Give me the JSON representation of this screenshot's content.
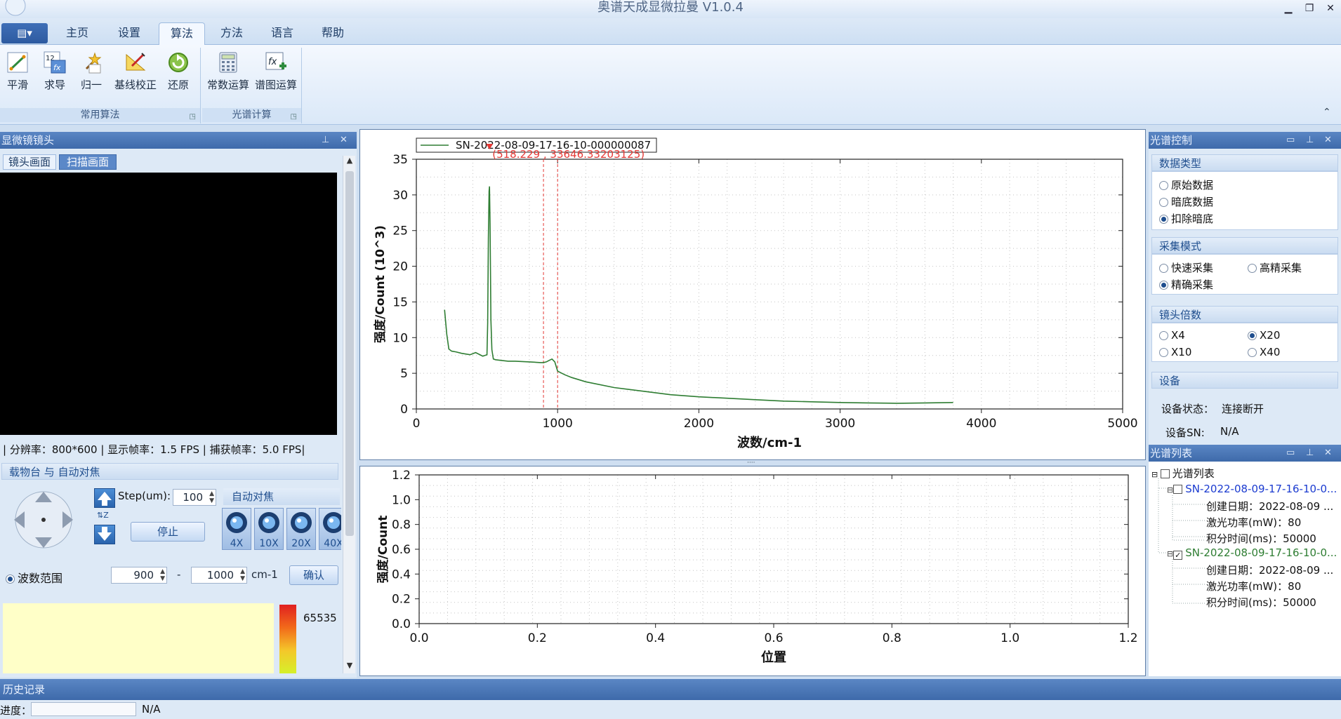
{
  "window": {
    "title": "奥谱天成显微拉曼 V1.0.4",
    "min": "▁",
    "max": "❐",
    "close": "✕"
  },
  "ribbon": {
    "app_menu": "▤▾",
    "tabs": [
      {
        "label": "主页"
      },
      {
        "label": "设置"
      },
      {
        "label": "算法"
      },
      {
        "label": "方法"
      },
      {
        "label": "语言"
      },
      {
        "label": "帮助"
      }
    ],
    "active_tab": "算法",
    "groups": [
      {
        "label": "常用算法",
        "buttons": [
          {
            "label": "平滑",
            "icon": "smooth-icon"
          },
          {
            "label": "求导",
            "icon": "derivative-icon"
          },
          {
            "label": "归一",
            "icon": "normalize-icon"
          },
          {
            "label": "基线校正",
            "icon": "baseline-icon"
          },
          {
            "label": "还原",
            "icon": "restore-icon"
          }
        ]
      },
      {
        "label": "光谱计算",
        "buttons": [
          {
            "label": "常数运算",
            "icon": "calculator-icon"
          },
          {
            "label": "谱图运算",
            "icon": "formula-icon"
          }
        ]
      }
    ],
    "collapse": "⌃"
  },
  "left_panel": {
    "title": "显微镜镜头",
    "tabs": [
      {
        "label": "镜头画面"
      },
      {
        "label": "扫描画面"
      }
    ],
    "status": "| 分辨率：800*600 | 显示帧率：1.5 FPS | 捕获帧率：5.0 FPS|",
    "stage_title": "载物台 与 自动对焦",
    "step_label": "Step(um):",
    "step_value": "100",
    "stop_button": "停止",
    "autofocus_label": "自动对焦",
    "lenses": [
      {
        "label": "4X"
      },
      {
        "label": "10X"
      },
      {
        "label": "20X"
      },
      {
        "label": "40X"
      }
    ],
    "range_label": "波数范围",
    "range_min": "900",
    "range_sep": "-",
    "range_max": "1000",
    "range_unit": "cm-1",
    "confirm_button": "确认",
    "colorbar_max": "65535"
  },
  "right_panel": {
    "spectrum_control_title": "光谱控制",
    "data_type_title": "数据类型",
    "data_types": [
      {
        "label": "原始数据",
        "selected": false
      },
      {
        "label": "暗底数据",
        "selected": false
      },
      {
        "label": "扣除暗底",
        "selected": true
      }
    ],
    "acq_mode_title": "采集模式",
    "acq_modes": [
      {
        "label": "快速采集",
        "selected": false
      },
      {
        "label": "高精采集",
        "selected": false
      },
      {
        "label": "精确采集",
        "selected": true
      }
    ],
    "lens_title": "镜头倍数",
    "lens_options": [
      {
        "label": "X4",
        "selected": false
      },
      {
        "label": "X20",
        "selected": true
      },
      {
        "label": "X10",
        "selected": false
      },
      {
        "label": "X40",
        "selected": false
      }
    ],
    "device_title": "设备",
    "device_status_label": "设备状态：",
    "device_status": "连接断开",
    "device_sn_label": "设备SN:",
    "device_sn": "N/A",
    "spectrum_list_title": "光谱列表",
    "tree_root": "光谱列表",
    "items": [
      {
        "name": "SN-2022-08-09-17-16-10-0...",
        "checked": false,
        "date": "创建日期：2022-08-09 ...",
        "power": "激光功率(mW)：80",
        "time": "积分时间(ms)：50000"
      },
      {
        "name": "SN-2022-08-09-17-16-10-0...",
        "checked": true,
        "date": "创建日期：2022-08-09 ...",
        "power": "激光功率(mW)：80",
        "time": "积分时间(ms)：50000"
      }
    ]
  },
  "bottom": {
    "history_title": "历史记录",
    "progress_label": "进度：",
    "progress_text": "N/A"
  },
  "chart_data": [
    {
      "type": "line",
      "legend": "SN-2022-08-09-17-16-10-000000087",
      "cursor_label": "(518.229 , 33646.33203125)",
      "xlabel": "波数/cm-1",
      "ylabel": "强度/Count (10^3)",
      "xlim": [
        0,
        5000
      ],
      "ylim": [
        0,
        35
      ],
      "xticks": [
        0,
        1000,
        2000,
        3000,
        4000,
        5000
      ],
      "yticks": [
        0,
        5,
        10,
        15,
        20,
        25,
        30,
        35
      ],
      "grid": true,
      "color": "#2e7d32",
      "vlines": [
        900,
        1000
      ],
      "vline_color": "#e53935",
      "series": [
        {
          "name": "SN-2022-08-09-17-16-10-000000087",
          "x": [
            200,
            215,
            230,
            250,
            280,
            320,
            380,
            420,
            470,
            500,
            505,
            510,
            515,
            518,
            522,
            528,
            535,
            545,
            560,
            600,
            650,
            700,
            800,
            880,
            900,
            920,
            940,
            960,
            980,
            1000,
            1050,
            1100,
            1200,
            1400,
            1600,
            1800,
            2000,
            2200,
            2400,
            2600,
            2800,
            3000,
            3200,
            3400,
            3600,
            3800
          ],
          "y": [
            13.9,
            10.5,
            8.4,
            8.1,
            8.0,
            7.8,
            7.6,
            7.9,
            7.4,
            7.6,
            12.0,
            24.0,
            30.5,
            31.2,
            26.0,
            12.5,
            8.3,
            7.0,
            6.9,
            6.8,
            6.7,
            6.7,
            6.6,
            6.5,
            6.5,
            6.6,
            6.8,
            7.0,
            6.6,
            5.3,
            4.8,
            4.4,
            3.8,
            3.0,
            2.5,
            2.0,
            1.7,
            1.5,
            1.3,
            1.1,
            1.0,
            0.9,
            0.85,
            0.8,
            0.85,
            0.9
          ]
        }
      ]
    },
    {
      "type": "line",
      "xlabel": "位置",
      "ylabel": "强度/Count",
      "xlim": [
        0,
        1.2
      ],
      "ylim": [
        0,
        1.2
      ],
      "xticks": [
        "0.0",
        "0.2",
        "0.4",
        "0.6",
        "0.8",
        "1.0",
        "1.2"
      ],
      "yticks": [
        "0.0",
        "0.2",
        "0.4",
        "0.6",
        "0.8",
        "1.0",
        "1.2"
      ],
      "grid": true,
      "series": []
    }
  ]
}
